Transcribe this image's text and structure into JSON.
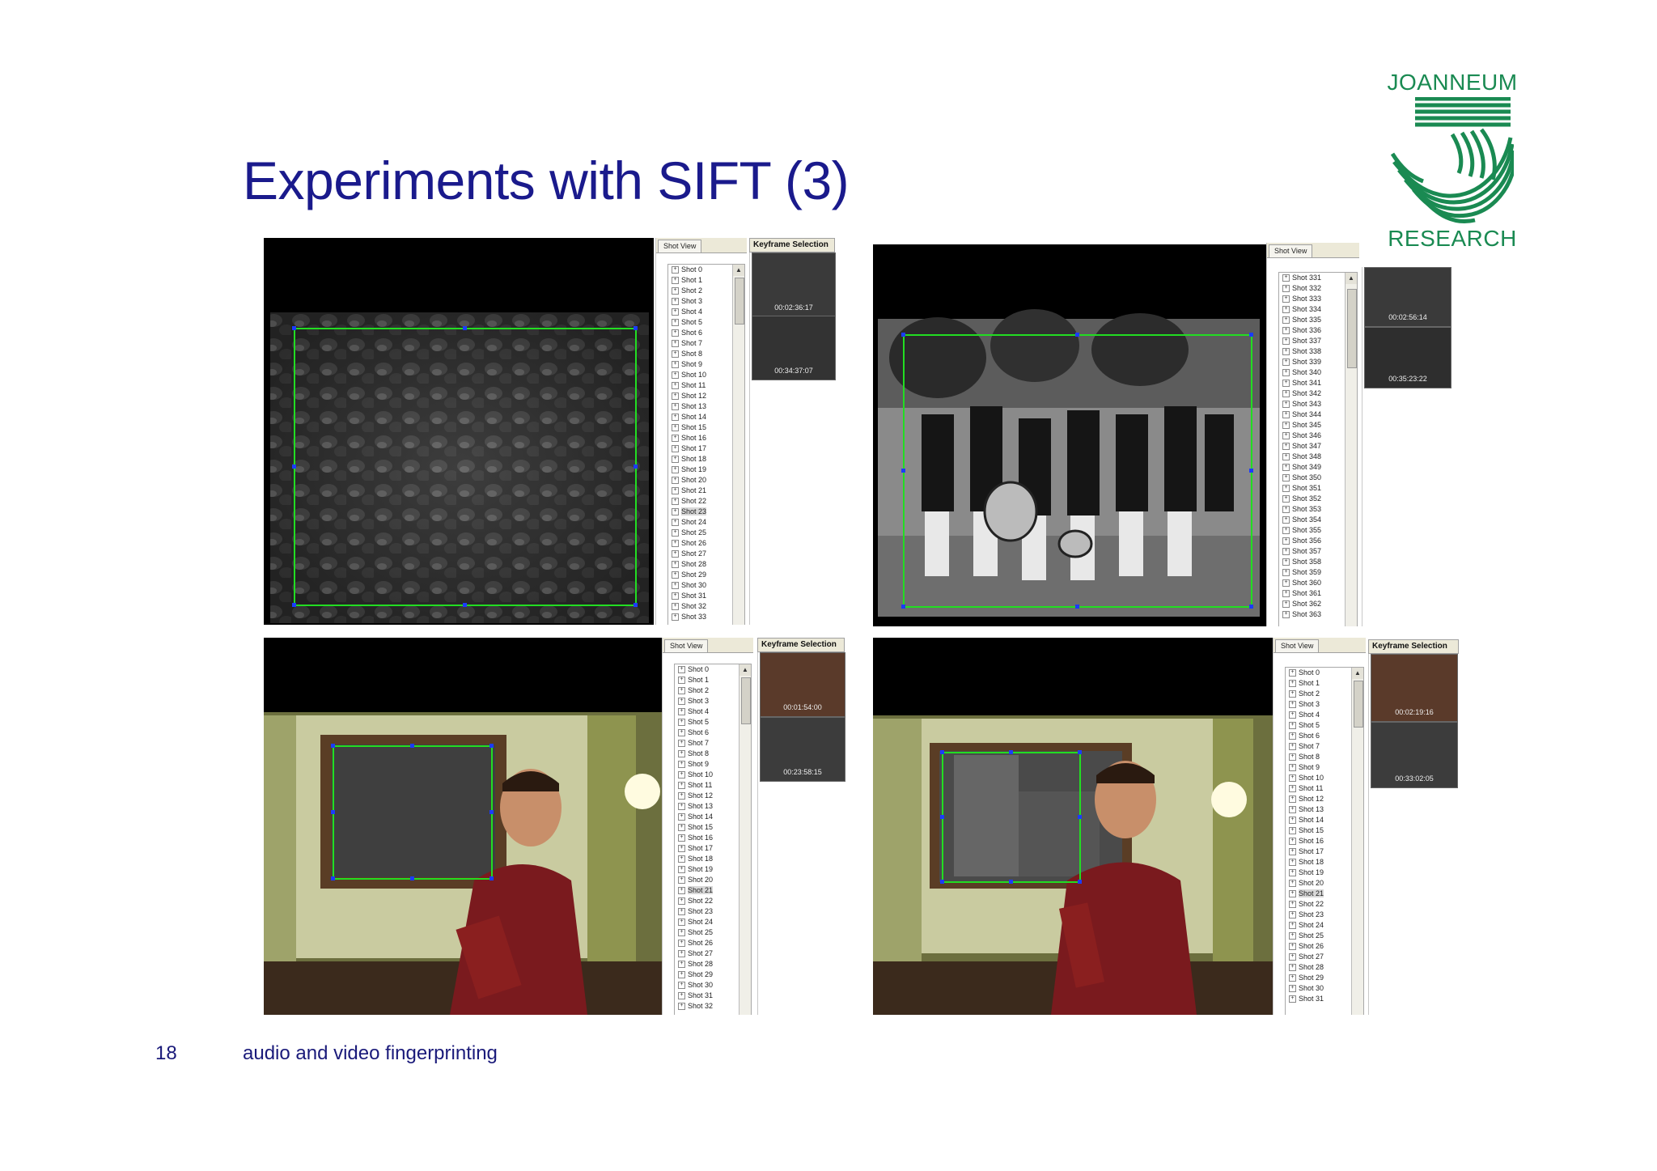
{
  "slide": {
    "title": "Experiments with SIFT (3)",
    "page_number": "18",
    "footer": "audio and video fingerprinting"
  },
  "logo": {
    "top_text": "JOANNEUM",
    "bottom_text": "RESEARCH",
    "color": "#1a8a52"
  },
  "colors": {
    "title": "#1a1a8c",
    "detection_box": "#22dd22",
    "box_handles": "#1a3cff"
  },
  "screenshots": [
    {
      "tab_shot_view": "Shot View",
      "tab_keyframe": "Keyframe Selection",
      "shots": [
        "Shot 0",
        "Shot 1",
        "Shot 2",
        "Shot 3",
        "Shot 4",
        "Shot 5",
        "Shot 6",
        "Shot 7",
        "Shot 8",
        "Shot 9",
        "Shot 10",
        "Shot 11",
        "Shot 12",
        "Shot 13",
        "Shot 14",
        "Shot 15",
        "Shot 16",
        "Shot 17",
        "Shot 18",
        "Shot 19",
        "Shot 20",
        "Shot 21",
        "Shot 22",
        "Shot 23",
        "Shot 24",
        "Shot 25",
        "Shot 26",
        "Shot 27",
        "Shot 28",
        "Shot 29",
        "Shot 30",
        "Shot 31",
        "Shot 32",
        "Shot 33"
      ],
      "selected": "Shot 23",
      "keyframes": [
        "00:02:36:17",
        "00:34:37:07"
      ]
    },
    {
      "tab_shot_view": "Shot View",
      "shots": [
        "Shot 331",
        "Shot 332",
        "Shot 333",
        "Shot 334",
        "Shot 335",
        "Shot 336",
        "Shot 337",
        "Shot 338",
        "Shot 339",
        "Shot 340",
        "Shot 341",
        "Shot 342",
        "Shot 343",
        "Shot 344",
        "Shot 345",
        "Shot 346",
        "Shot 347",
        "Shot 348",
        "Shot 349",
        "Shot 350",
        "Shot 351",
        "Shot 352",
        "Shot 353",
        "Shot 354",
        "Shot 355",
        "Shot 356",
        "Shot 357",
        "Shot 358",
        "Shot 359",
        "Shot 360",
        "Shot 361",
        "Shot 362",
        "Shot 363"
      ],
      "keyframes": [
        "00:02:56:14",
        "00:35:23:22"
      ]
    },
    {
      "tab_shot_view": "Shot View",
      "tab_keyframe": "Keyframe Selection",
      "shots": [
        "Shot 0",
        "Shot 1",
        "Shot 2",
        "Shot 3",
        "Shot 4",
        "Shot 5",
        "Shot 6",
        "Shot 7",
        "Shot 8",
        "Shot 9",
        "Shot 10",
        "Shot 11",
        "Shot 12",
        "Shot 13",
        "Shot 14",
        "Shot 15",
        "Shot 16",
        "Shot 17",
        "Shot 18",
        "Shot 19",
        "Shot 20",
        "Shot 21",
        "Shot 22",
        "Shot 23",
        "Shot 24",
        "Shot 25",
        "Shot 26",
        "Shot 27",
        "Shot 28",
        "Shot 29",
        "Shot 30",
        "Shot 31",
        "Shot 32"
      ],
      "selected": "Shot 21",
      "keyframes": [
        "00:01:54:00",
        "00:23:58:15"
      ]
    },
    {
      "tab_shot_view": "Shot View",
      "tab_keyframe": "Keyframe Selection",
      "shots": [
        "Shot 0",
        "Shot 1",
        "Shot 2",
        "Shot 3",
        "Shot 4",
        "Shot 5",
        "Shot 6",
        "Shot 7",
        "Shot 8",
        "Shot 9",
        "Shot 10",
        "Shot 11",
        "Shot 12",
        "Shot 13",
        "Shot 14",
        "Shot 15",
        "Shot 16",
        "Shot 17",
        "Shot 18",
        "Shot 19",
        "Shot 20",
        "Shot 21",
        "Shot 22",
        "Shot 23",
        "Shot 24",
        "Shot 25",
        "Shot 26",
        "Shot 27",
        "Shot 28",
        "Shot 29",
        "Shot 30",
        "Shot 31"
      ],
      "selected": "Shot 21",
      "keyframes": [
        "00:02:19:16",
        "00:33:02:05"
      ]
    }
  ]
}
